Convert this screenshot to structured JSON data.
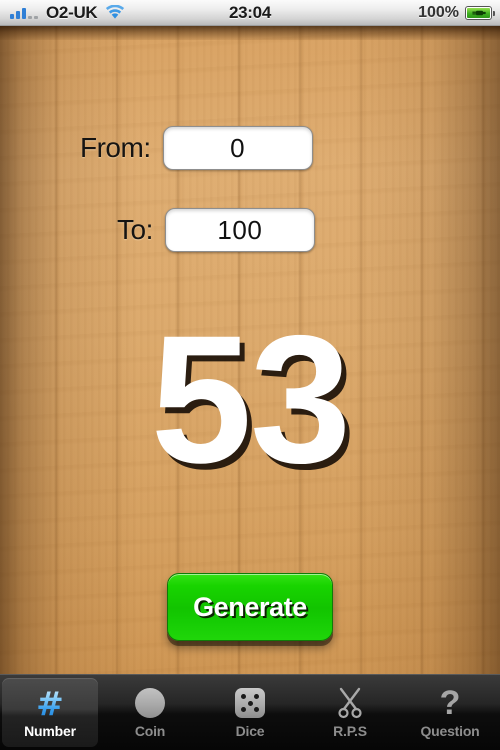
{
  "status_bar": {
    "carrier": "O2-UK",
    "time": "23:04",
    "battery_percent": "100%",
    "signal_bars_total": 5,
    "signal_bars_filled": 3,
    "wifi_icon": "wifi-icon",
    "battery_icon": "battery-charging-icon"
  },
  "main": {
    "from_label": "From:",
    "from_value": "0",
    "to_label": "To:",
    "to_value": "100",
    "result": "53",
    "generate_label": "Generate"
  },
  "tabs": [
    {
      "label": "Number",
      "icon": "hash-icon",
      "selected": true
    },
    {
      "label": "Coin",
      "icon": "coin-icon",
      "selected": false
    },
    {
      "label": "Dice",
      "icon": "dice-icon",
      "selected": false
    },
    {
      "label": "R.P.S",
      "icon": "scissors-icon",
      "selected": false
    },
    {
      "label": "Question",
      "icon": "question-icon",
      "selected": false
    }
  ],
  "colors": {
    "wood_base": "#DCAA6D",
    "wood_dark_edge": "#6B3C12",
    "button_green": "#14C800",
    "result_white": "#FFFFFF",
    "tabbar_black": "#0D0D0D",
    "tab_selected_text": "#FFFFFF",
    "tab_text": "#8D8D8D",
    "hash_blue": "#3DA2EF",
    "signal_blue": "#2F7FD6",
    "battery_green": "#3FB021"
  }
}
